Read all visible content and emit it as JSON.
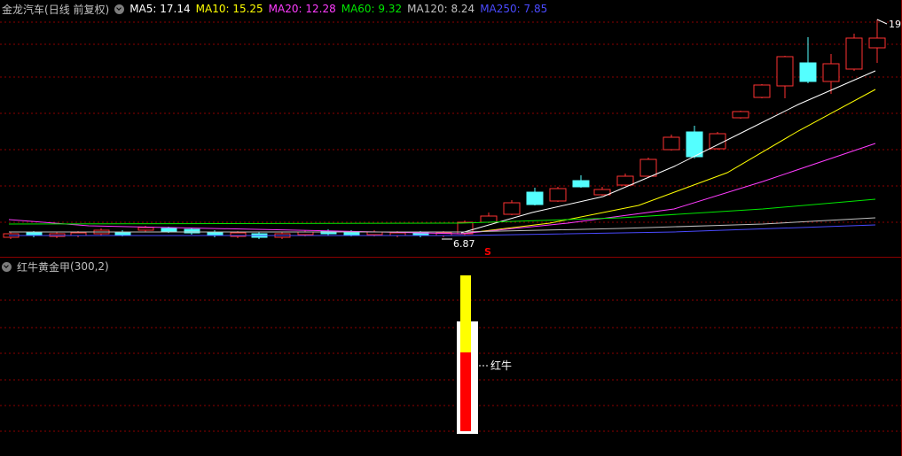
{
  "main": {
    "title": "金龙汽车",
    "period": "(日线 前复权)",
    "indicators": [
      {
        "label": "MA5: 17.14",
        "color": "#ffffff"
      },
      {
        "label": "MA10: 15.25",
        "color": "#ffff00"
      },
      {
        "label": "MA20: 12.28",
        "color": "#ff3cff"
      },
      {
        "label": "MA60: 9.32",
        "color": "#00e600"
      },
      {
        "label": "MA120: 8.24",
        "color": "#c0c0c0"
      },
      {
        "label": "MA250: 7.85",
        "color": "#4a4aff"
      }
    ],
    "high_marker": "19",
    "low_marker": "6.87",
    "signal_marker": "S"
  },
  "indicator_panel": {
    "title": "红牛黄金甲",
    "params": "(300,2)",
    "bar_label": "红牛"
  },
  "colors": {
    "up": "#ff3232",
    "down": "#54ffff",
    "grid": "#8b0000",
    "yellow": "#ffff00",
    "red": "#ff0000",
    "white": "#ffffff"
  }
}
